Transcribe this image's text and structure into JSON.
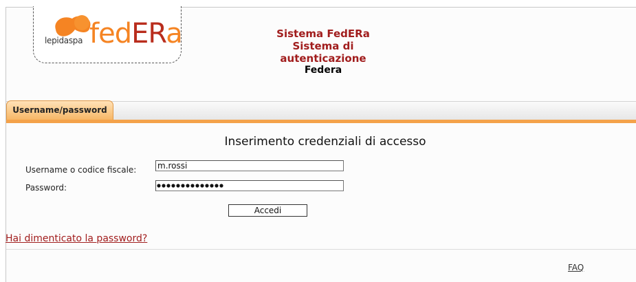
{
  "logo": {
    "lepida_text": "lepidaspa",
    "federa_part1": "fed",
    "federa_part2": "ER",
    "federa_part3": "a",
    "colors": {
      "orange": "#f58423",
      "red": "#b92d1d"
    }
  },
  "header": {
    "title_line1": "Sistema FedERa",
    "title_line2": "Sistema di autenticazione",
    "organization": "Federa"
  },
  "tabs": [
    {
      "label": "Username/password",
      "active": true
    }
  ],
  "form": {
    "title": "Inserimento credenziali di accesso",
    "username_label": "Username o codice fiscale:",
    "username_value": "m.rossi",
    "password_label": "Password:",
    "password_length": 14,
    "submit_label": "Accedi"
  },
  "links": {
    "forgot_password": "Hai dimenticato la password?",
    "faq": "FAQ"
  }
}
